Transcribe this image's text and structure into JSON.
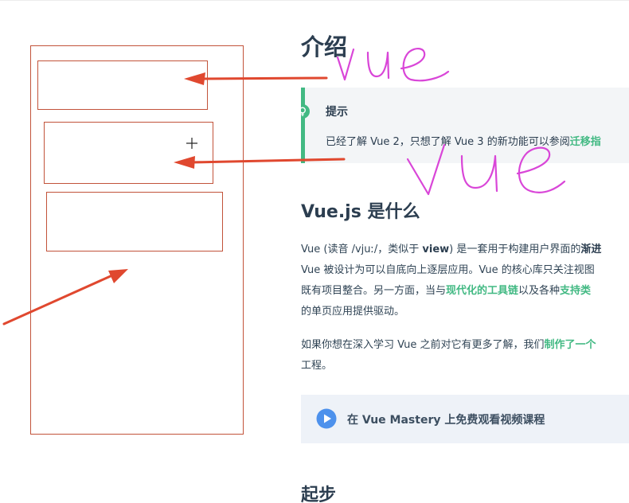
{
  "page": {
    "title": "介绍",
    "tip": {
      "title": "提示",
      "text_prefix": "已经了解 Vue 2，只想了解 Vue 3 的新功能可以参阅",
      "link": "迁移指"
    },
    "section1": {
      "heading": "Vue.js 是什么",
      "p1": {
        "l1_a": "Vue (读音 /vjuː/，类似于 ",
        "l1_b": "view",
        "l1_c": ") 是一套用于构建用户界面的",
        "l1_d": "渐进",
        "l2": "Vue 被设计为可以自底向上逐层应用。Vue 的核心库只关注视图",
        "l3_a": "既有项目整合。另一方面，当与",
        "l3_b": "现代化的工具链",
        "l3_c": "以及各种",
        "l3_d": "支持类",
        "l4": "的单页应用提供驱动。"
      },
      "p2": {
        "l1_a": "如果你想在深入学习 Vue 之前对它有更多了解，我们",
        "l1_b": "制作了一个",
        "l2": "工程。"
      }
    },
    "mastery": {
      "label": "在 Vue Mastery 上免费观看视频课程",
      "icon": "play-circle-icon"
    },
    "section2": {
      "heading": "起步"
    }
  },
  "annotations": {
    "handwriting_1": "vue",
    "handwriting_2": "vue",
    "stroke_color": "#d946d8",
    "arrow_color": "#e0482f"
  },
  "colors": {
    "accent": "#42b983",
    "text": "#2c3e50"
  }
}
